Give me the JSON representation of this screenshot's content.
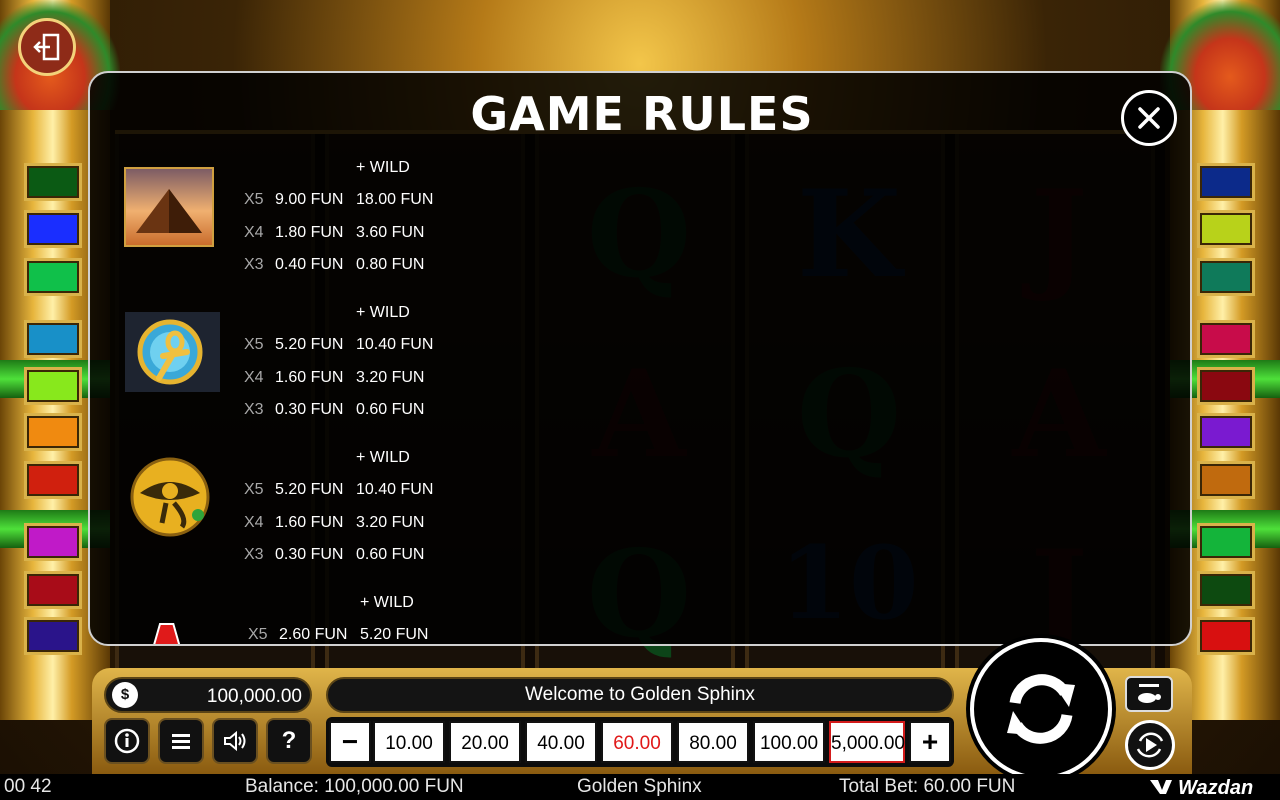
{
  "dialog": {
    "title": "GAME RULES",
    "close_icon": "close-icon",
    "paytable": [
      {
        "symbol": "pyramid",
        "wild_header": "+ WILD",
        "rows": [
          {
            "multiplier": "X5",
            "base": "9.00 FUN",
            "with_wild": "18.00 FUN"
          },
          {
            "multiplier": "X4",
            "base": "1.80 FUN",
            "with_wild": "3.60 FUN"
          },
          {
            "multiplier": "X3",
            "base": "0.40 FUN",
            "with_wild": "0.80 FUN"
          }
        ]
      },
      {
        "symbol": "ankh",
        "wild_header": "+ WILD",
        "rows": [
          {
            "multiplier": "X5",
            "base": "5.20 FUN",
            "with_wild": "10.40 FUN"
          },
          {
            "multiplier": "X4",
            "base": "1.60 FUN",
            "with_wild": "3.20 FUN"
          },
          {
            "multiplier": "X3",
            "base": "0.30 FUN",
            "with_wild": "0.60 FUN"
          }
        ]
      },
      {
        "symbol": "eye-of-horus",
        "wild_header": "+ WILD",
        "rows": [
          {
            "multiplier": "X5",
            "base": "5.20 FUN",
            "with_wild": "10.40 FUN"
          },
          {
            "multiplier": "X4",
            "base": "1.60 FUN",
            "with_wild": "3.20 FUN"
          },
          {
            "multiplier": "X3",
            "base": "0.30 FUN",
            "with_wild": "0.60 FUN"
          }
        ]
      },
      {
        "symbol": "letter-a",
        "wild_header": "+ WILD",
        "rows": [
          {
            "multiplier": "X5",
            "base": "2.60 FUN",
            "with_wild": "5.20 FUN"
          }
        ]
      }
    ]
  },
  "controls": {
    "balance_value": "100,000.00",
    "balance_icon": "money-bag-icon",
    "message": "Welcome to Golden Sphinx",
    "bet_options": [
      "10.00",
      "20.00",
      "40.00",
      "60.00",
      "80.00",
      "100.00",
      "5,000.00"
    ],
    "selected_bet": "60.00",
    "minus_label": "−",
    "plus_label": "+",
    "buttons": [
      "info-icon",
      "menu-icon",
      "sound-icon",
      "help-icon"
    ],
    "help_label": "?"
  },
  "status": {
    "clock": "00 42",
    "balance": "Balance: 100,000.00 FUN",
    "game": "Golden Sphinx",
    "total_bet": "Total Bet: 60.00 FUN",
    "brand": "Wazdan"
  },
  "colors": {
    "selected_bet": "#e01818",
    "gold": "#d9b24a"
  },
  "payline_markers": {
    "left": [
      "#0b5a14",
      "#1a2eff",
      "#10c04a",
      "#1890c8",
      "#88e81c",
      "#f08a10",
      "#d0200e",
      "#c01ac8",
      "#a80c18",
      "#2a148a"
    ],
    "right": [
      "#0c2a8a",
      "#b8d21a",
      "#0f7a5a",
      "#c80c4a",
      "#8a0810",
      "#7a1ad0",
      "#c06a0e",
      "#14b43a",
      "#0d4a10",
      "#d81010"
    ]
  }
}
